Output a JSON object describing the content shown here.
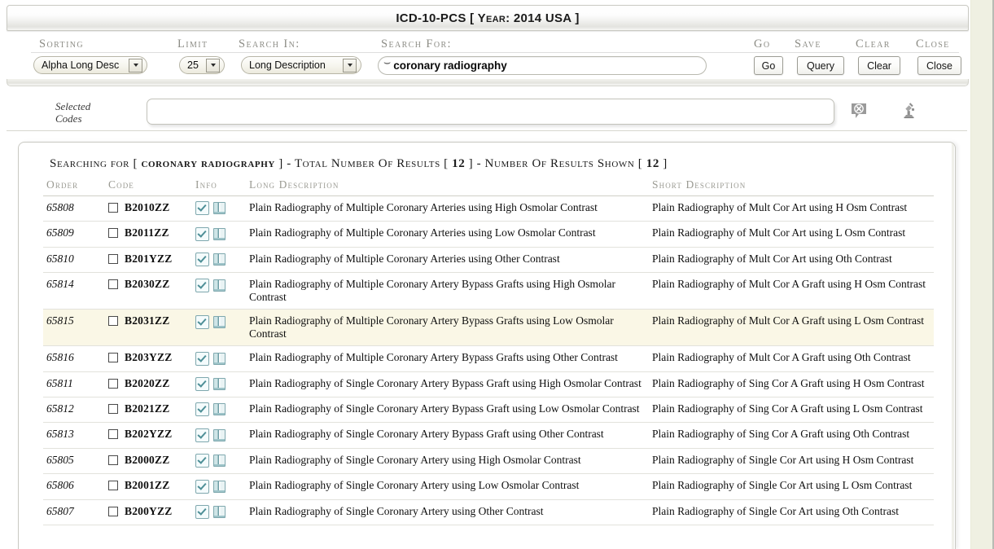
{
  "window": {
    "title": "ICD-10-PCS [ Year: 2014 USA ]"
  },
  "toolbar": {
    "labels": {
      "sorting": "Sorting",
      "limit": "Limit",
      "search_in": "Search In:",
      "search_for": "Search For:",
      "go": "Go",
      "save": "Save",
      "clear": "Clear",
      "close": "Close"
    },
    "sorting_value": "Alpha Long Desc",
    "limit_value": "25",
    "search_in_value": "Long Description",
    "search_for_value": "coronary radiography",
    "search_for_placeholder": "",
    "buttons": {
      "go": "Go",
      "save": "Query",
      "clear": "Clear",
      "close": "Close"
    }
  },
  "selected_codes": {
    "label_line1": "Selected",
    "label_line2": "Codes",
    "value": "",
    "placeholder": "",
    "icons": {
      "clear": "speech-bubble-x-icon",
      "analyze": "microscope-icon"
    }
  },
  "results": {
    "searching_prefix": "Searching for [",
    "search_term": "coronary radiography",
    "middle_text": "] - Total Number Of Results [",
    "total_results": "12",
    "shown_prefix": "] - Number Of Results Shown [",
    "results_shown": "12",
    "suffix": "]",
    "columns": {
      "order": "Order",
      "code": "Code",
      "info": "Info",
      "long_description": "Long Description",
      "short_description": "Short Description"
    },
    "highlight_color": "#faf7e6",
    "rows": [
      {
        "order": "65808",
        "code": "B2010ZZ",
        "long": "Plain Radiography of Multiple Coronary Arteries using High Osmolar Contrast",
        "short": "Plain Radiography of Mult Cor Art using H Osm Contrast",
        "highlighted": false
      },
      {
        "order": "65809",
        "code": "B2011ZZ",
        "long": "Plain Radiography of Multiple Coronary Arteries using Low Osmolar Contrast",
        "short": "Plain Radiography of Mult Cor Art using L Osm Contrast",
        "highlighted": false
      },
      {
        "order": "65810",
        "code": "B201YZZ",
        "long": "Plain Radiography of Multiple Coronary Arteries using Other Contrast",
        "short": "Plain Radiography of Mult Cor Art using Oth Contrast",
        "highlighted": false
      },
      {
        "order": "65814",
        "code": "B2030ZZ",
        "long": "Plain Radiography of Multiple Coronary Artery Bypass Grafts using High Osmolar Contrast",
        "short": "Plain Radiography of Mult Cor A Graft using H Osm Contrast",
        "highlighted": false
      },
      {
        "order": "65815",
        "code": "B2031ZZ",
        "long": "Plain Radiography of Multiple Coronary Artery Bypass Grafts using Low Osmolar Contrast",
        "short": "Plain Radiography of Mult Cor A Graft using L Osm Contrast",
        "highlighted": true
      },
      {
        "order": "65816",
        "code": "B203YZZ",
        "long": "Plain Radiography of Multiple Coronary Artery Bypass Grafts using Other Contrast",
        "short": "Plain Radiography of Mult Cor A Graft using Oth Contrast",
        "highlighted": false
      },
      {
        "order": "65811",
        "code": "B2020ZZ",
        "long": "Plain Radiography of Single Coronary Artery Bypass Graft using High Osmolar Contrast",
        "short": "Plain Radiography of Sing Cor A Graft using H Osm Contrast",
        "highlighted": false
      },
      {
        "order": "65812",
        "code": "B2021ZZ",
        "long": "Plain Radiography of Single Coronary Artery Bypass Graft using Low Osmolar Contrast",
        "short": "Plain Radiography of Sing Cor A Graft using L Osm Contrast",
        "highlighted": false
      },
      {
        "order": "65813",
        "code": "B202YZZ",
        "long": "Plain Radiography of Single Coronary Artery Bypass Graft using Other Contrast",
        "short": "Plain Radiography of Sing Cor A Graft using Oth Contrast",
        "highlighted": false
      },
      {
        "order": "65805",
        "code": "B2000ZZ",
        "long": "Plain Radiography of Single Coronary Artery using High Osmolar Contrast",
        "short": "Plain Radiography of Single Cor Art using H Osm Contrast",
        "highlighted": false
      },
      {
        "order": "65806",
        "code": "B2001ZZ",
        "long": "Plain Radiography of Single Coronary Artery using Low Osmolar Contrast",
        "short": "Plain Radiography of Single Cor Art using L Osm Contrast",
        "highlighted": false
      },
      {
        "order": "65807",
        "code": "B200YZZ",
        "long": "Plain Radiography of Single Coronary Artery using Other Contrast",
        "short": "Plain Radiography of Single Cor Art using Oth Contrast",
        "highlighted": false
      }
    ]
  }
}
